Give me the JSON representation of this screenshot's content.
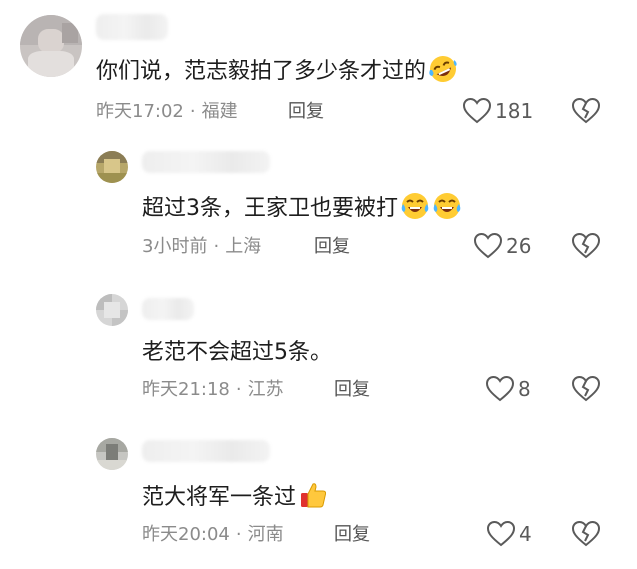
{
  "comments": [
    {
      "text": "你们说，范志毅拍了多少条才过的",
      "emoji_icon": "rolling-on-floor-laughing-icon",
      "time": "昨天17:02",
      "location": "福建",
      "reply_label": "回复",
      "likes": "181",
      "is_reply": false
    },
    {
      "text": "超过3条，王家卫也要被打",
      "emoji_icon": "crying-laughing-icon",
      "emoji_count": 2,
      "time": "3小时前",
      "location": "上海",
      "reply_label": "回复",
      "likes": "26",
      "is_reply": true
    },
    {
      "text": "老范不会超过5条。",
      "time": "昨天21:18",
      "location": "江苏",
      "reply_label": "回复",
      "likes": "8",
      "is_reply": true
    },
    {
      "text": "范大将军一条过",
      "emoji_icon": "thumbs-up-icon",
      "time": "昨天20:04",
      "location": "河南",
      "reply_label": "回复",
      "likes": "4",
      "is_reply": true
    }
  ],
  "colors": {
    "text": "#1d1d1d",
    "meta": "#8b8b8b",
    "reply": "#555555",
    "icon": "#5a5a5a",
    "background": "#ffffff"
  }
}
